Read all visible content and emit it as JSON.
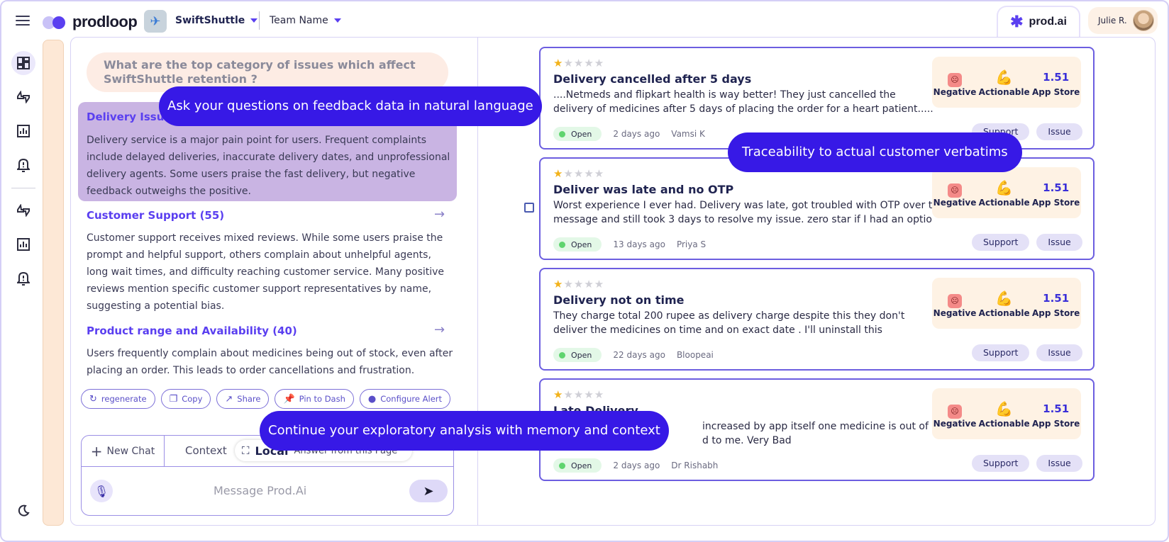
{
  "header": {
    "brand": "prodloop",
    "app_name": "SwiftShuttle",
    "team": "Team Name",
    "assistant_tab": "prod.ai",
    "user_name": "Julie R."
  },
  "nav": {
    "icons": [
      "dashboard-icon",
      "thumbs-icon",
      "chart-icon",
      "bell-icon",
      "thumbs-icon",
      "chart-icon",
      "bell-icon",
      "moon-icon"
    ]
  },
  "chat": {
    "question": "What are the top category of issues which affect SwiftShuttle retention ?",
    "categories": [
      {
        "title": "Delivery Issues",
        "body": "Delivery service is a major pain point for users. Frequent complaints include delayed deliveries, inaccurate delivery dates, and unprofessional delivery agents. Some users praise the fast delivery, but negative feedback outweighs the positive."
      },
      {
        "title": "Customer Support (55)",
        "body": "Customer support receives mixed reviews. While some users praise the prompt and helpful support, others complain about unhelpful agents, long wait times, and difficulty reaching customer service. Many positive reviews mention specific customer support representatives by name, suggesting a potential bias."
      },
      {
        "title": "Product range and Availability (40)",
        "body": "Users frequently complain about medicines being out of stock, even after placing an order. This leads to order cancellations and frustration."
      }
    ],
    "actions": [
      "regenerate",
      "Copy",
      "Share",
      "Pin to Dash",
      "Configure Alert"
    ],
    "tabs": {
      "new_chat": "New Chat",
      "context": "Context",
      "local": "Local",
      "answer_from": "Answer from this Page"
    },
    "input_placeholder": "Message Prod.Ai"
  },
  "feedback": [
    {
      "rating": 1,
      "title": "Delivery cancelled after 5 days",
      "body1": "....Netmeds and flipkart health is way better! They just cancelled the",
      "body2": "delivery of medicines after 5 days of placing the order for a heart patient......",
      "status": "Open",
      "age": "2 days ago",
      "author": "Vamsi  K"
    },
    {
      "rating": 1,
      "title": "Deliver was late and no OTP",
      "body1": "Worst experience I ever had. Delivery was late, got troubled with OTP over text",
      "body2": "message and still took 3 days to resolve my issue. zero star if I had an option.",
      "status": "Open",
      "age": "13 days ago",
      "author": "Priya S"
    },
    {
      "rating": 1,
      "title": "Delivery not on time",
      "body1": "They charge total 200 rupee as delivery charge despite this they don't",
      "body2": "deliver the medicines on time and on exact date .  I'll uninstall this",
      "status": "Open",
      "age": "22 days ago",
      "author": "Bloopeai"
    },
    {
      "rating": 1,
      "title": "Late Delivery",
      "body1": "increased by app itself one medicine is out of",
      "body2": "d to me. Very Bad",
      "status": "Open",
      "age": "2 days ago",
      "author": "Dr Rishabh"
    }
  ],
  "tags": {
    "sentiment": "Negative",
    "type": "Actionable",
    "score": "1.51",
    "source": "App Store"
  },
  "card_buttons": {
    "support": "Support",
    "issue": "Issue"
  },
  "callouts": {
    "natural_language": "Ask your questions on feedback data in natural language",
    "traceability": "Traceability to actual customer verbatims",
    "memory": "Continue your exploratory analysis with memory and context"
  },
  "colors": {
    "accent": "#3719e6",
    "card_border": "#6c5ee0",
    "highlight": "#c9b4e3",
    "tag_bg": "#fef2e4"
  }
}
